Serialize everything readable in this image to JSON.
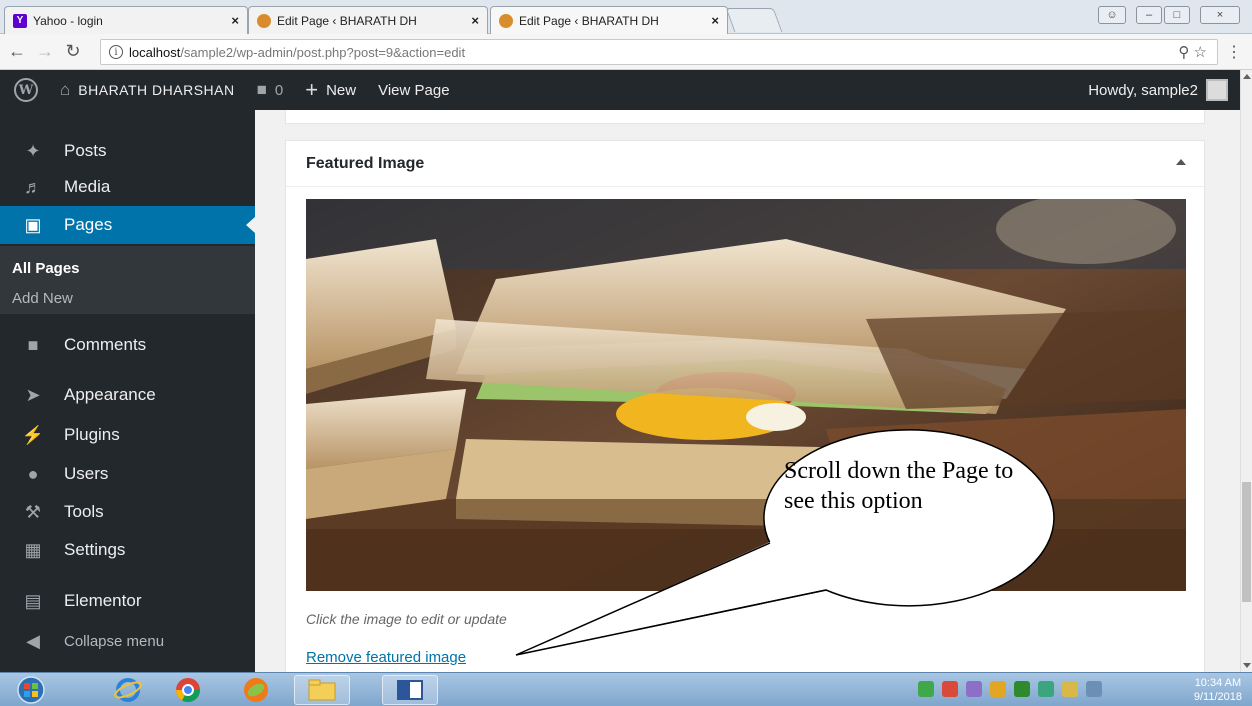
{
  "browser": {
    "tabs": [
      {
        "title": "Yahoo - login",
        "favicon": "yahoo-icon"
      },
      {
        "title": "Edit Page ‹ BHARATH DH",
        "favicon": "site-icon"
      },
      {
        "title": "Edit Page ‹ BHARATH DH",
        "favicon": "site-icon"
      }
    ],
    "close_glyph": "×",
    "url_host": "localhost",
    "url_path": "/sample2/wp-admin/post.php?post=9&action=edit"
  },
  "adminbar": {
    "site_name": "BHARATH DHARSHAN",
    "comments_count": "0",
    "new_label": "New",
    "view_label": "View Page",
    "howdy": "Howdy, sample2"
  },
  "sidebar": {
    "items": [
      {
        "label": "Posts",
        "icon": "pin-icon"
      },
      {
        "label": "Media",
        "icon": "media-icon"
      },
      {
        "label": "Pages",
        "icon": "pages-icon"
      },
      {
        "label": "Comments",
        "icon": "comment-icon"
      },
      {
        "label": "Appearance",
        "icon": "brush-icon"
      },
      {
        "label": "Plugins",
        "icon": "plugin-icon"
      },
      {
        "label": "Users",
        "icon": "user-icon"
      },
      {
        "label": "Tools",
        "icon": "wrench-icon"
      },
      {
        "label": "Settings",
        "icon": "settings-icon"
      },
      {
        "label": "Elementor",
        "icon": "elementor-icon"
      },
      {
        "label": "Collapse menu",
        "icon": "collapse-icon"
      }
    ],
    "submenu": [
      {
        "label": "All Pages"
      },
      {
        "label": "Add New"
      }
    ]
  },
  "featured_box": {
    "title": "Featured Image",
    "howto": "Click the image to edit or update",
    "remove_link": "Remove featured image"
  },
  "callout": {
    "text": "Scroll down the Page to see this option"
  },
  "taskbar": {
    "time": "10:34 AM",
    "date": "9/11/2018"
  },
  "colors": {
    "wp_dark": "#23282d",
    "wp_blue": "#0073aa"
  }
}
